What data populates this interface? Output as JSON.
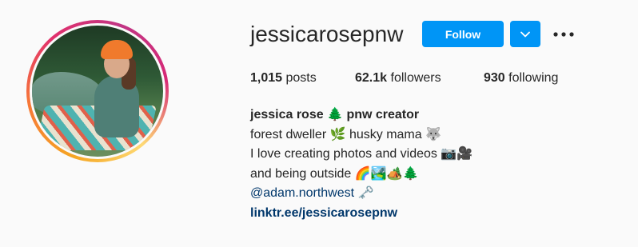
{
  "profile": {
    "username": "jessicarosepnw",
    "follow_label": "Follow",
    "stats": {
      "posts_count": "1,015",
      "posts_label": "posts",
      "followers_count": "62.1k",
      "followers_label": "followers",
      "following_count": "930",
      "following_label": "following"
    },
    "bio": {
      "full_name": "jessica rose 🌲 pnw creator",
      "lines": [
        "forest dweller 🌿 husky mama 🐺",
        "I love creating photos and videos 📷🎥",
        "and being outside 🌈🏞️🏕️🌲"
      ],
      "mention": "@adam.northwest",
      "mention_suffix": "🗝️",
      "link": "linktr.ee/jessicarosepnw"
    }
  },
  "colors": {
    "accent": "#0095f6",
    "link": "#00376b",
    "text": "#262626",
    "background": "#fafafa"
  },
  "icons": {
    "dropdown": "chevron-down-icon",
    "more": "more-options-icon"
  }
}
